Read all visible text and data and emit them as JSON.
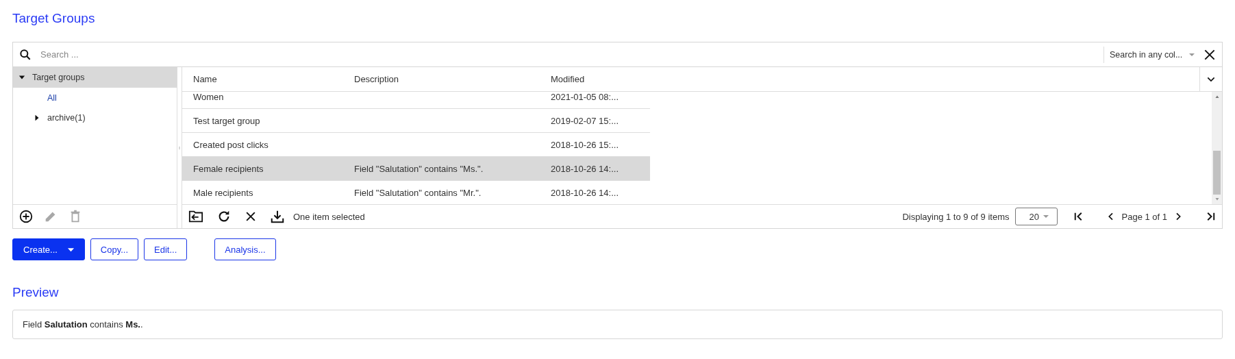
{
  "page_title": "Target Groups",
  "search": {
    "placeholder": "Search ...",
    "scope": "Search in any col..."
  },
  "tree": [
    {
      "label": "Target groups",
      "expanded": true,
      "selected": true,
      "children": [
        {
          "label": "All",
          "selected": false
        },
        {
          "label": "archive(1)",
          "expanded": false,
          "selected": false
        }
      ]
    }
  ],
  "table": {
    "columns": [
      "Name",
      "Description",
      "Modified"
    ],
    "rows": [
      {
        "name": "Women",
        "modified": "2021-01-05 08:...",
        "selected": false
      },
      {
        "name": "Test target group",
        "modified": "2019-02-07 15:...",
        "selected": false
      },
      {
        "name": "Created post clicks",
        "modified": "2018-10-26 15:...",
        "selected": false
      },
      {
        "name": "Female recipients",
        "description": "Field \"Salutation\" contains \"Ms.\".",
        "modified": "2018-10-26 14:...",
        "selected": true
      },
      {
        "name": "Male recipients",
        "description": "Field \"Salutation\" contains \"Mr.\".",
        "modified": "2018-10-26 14:...",
        "selected": false
      }
    ]
  },
  "footer": {
    "status": "One item selected",
    "summary": "Displaying 1 to 9 of 9 items",
    "page_size": "20",
    "page": "Page 1 of 1"
  },
  "buttons": [
    {
      "label": "Create...",
      "kind": "primary",
      "dropdown": true
    },
    {
      "label": "Copy...",
      "kind": "outline"
    },
    {
      "label": "Edit...",
      "kind": "outline"
    },
    {
      "label": "Analysis...",
      "kind": "outline"
    }
  ],
  "preview": {
    "title": "Preview",
    "text": "Field **Salutation** contains **Ms.**."
  }
}
